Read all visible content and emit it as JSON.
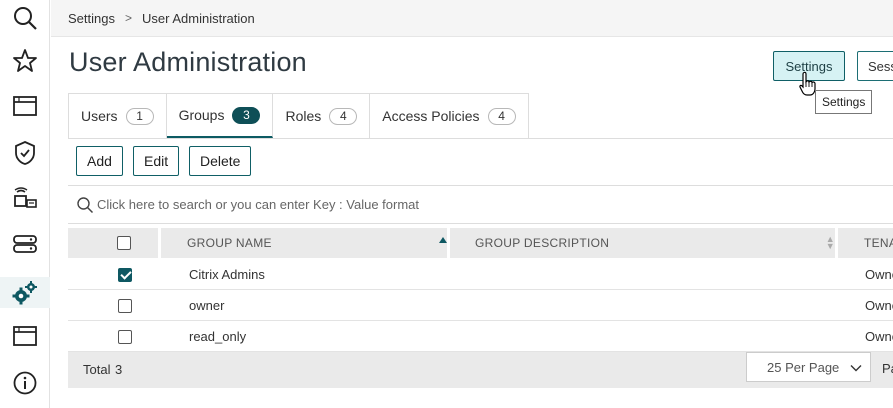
{
  "breadcrumb": {
    "root": "Settings",
    "separator": ">",
    "current": "User Administration"
  },
  "page": {
    "title": "User Administration"
  },
  "header_buttons": {
    "settings": "Settings",
    "sessions": "Sess"
  },
  "tooltip": "Settings",
  "tabs": [
    {
      "label": "Users",
      "count": "1",
      "active": false
    },
    {
      "label": "Groups",
      "count": "3",
      "active": true
    },
    {
      "label": "Roles",
      "count": "4",
      "active": false
    },
    {
      "label": "Access Policies",
      "count": "4",
      "active": false
    }
  ],
  "actions": {
    "add": "Add",
    "edit": "Edit",
    "delete": "Delete"
  },
  "search": {
    "placeholder": "Click here to search or you can enter Key : Value format"
  },
  "table": {
    "columns": {
      "group_name": "GROUP NAME",
      "group_description": "GROUP DESCRIPTION",
      "tenant": "TENA"
    },
    "rows": [
      {
        "name": "Citrix Admins",
        "description": "",
        "tenant": "Owne",
        "checked": true
      },
      {
        "name": "owner",
        "description": "",
        "tenant": "Owne",
        "checked": false
      },
      {
        "name": "read_only",
        "description": "",
        "tenant": "Owne",
        "checked": false
      }
    ]
  },
  "footer": {
    "total_label": "Total",
    "total_value": "3",
    "per_page": "25 Per Page",
    "page_label": "Pa"
  },
  "nav_icons": [
    "search-icon",
    "star-icon",
    "window-icon",
    "shield-icon",
    "devices-icon",
    "storage-icon",
    "settings-gears-icon",
    "window-icon",
    "info-icon"
  ],
  "colors": {
    "accent": "#0e5862",
    "active_button_bg": "#d6f2f4",
    "header_bg": "#eaeaea"
  }
}
